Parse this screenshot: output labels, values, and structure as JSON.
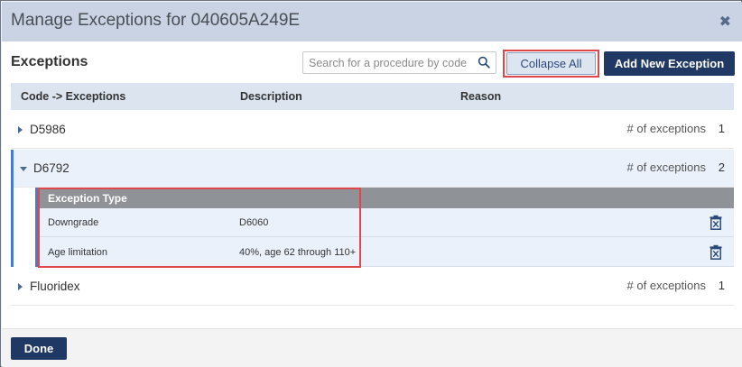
{
  "dialog": {
    "title": "Manage Exceptions for 040605A249E",
    "close_glyph": "✖"
  },
  "section": {
    "title": "Exceptions",
    "search_placeholder": "Search for a procedure by code",
    "collapse_all_label": "Collapse All",
    "add_new_label": "Add New Exception"
  },
  "table": {
    "headers": [
      "Code -> Exceptions",
      "Description",
      "Reason"
    ],
    "count_label": "# of exceptions",
    "rows": [
      {
        "code": "D5986",
        "count": "1",
        "expanded": false
      },
      {
        "code": "D6792",
        "count": "2",
        "expanded": true
      },
      {
        "code": "Fluoridex",
        "count": "1",
        "expanded": false
      }
    ],
    "sub_header": "Exception Type",
    "sub_rows": [
      {
        "type": "Downgrade",
        "description": "D6060"
      },
      {
        "type": "Age limitation",
        "description": "40%, age 62 through 110+"
      }
    ]
  },
  "footer": {
    "done_label": "Done"
  },
  "colors": {
    "primary": "#1f3864",
    "highlight": "#e0474c",
    "accent": "#4a7ac8"
  }
}
